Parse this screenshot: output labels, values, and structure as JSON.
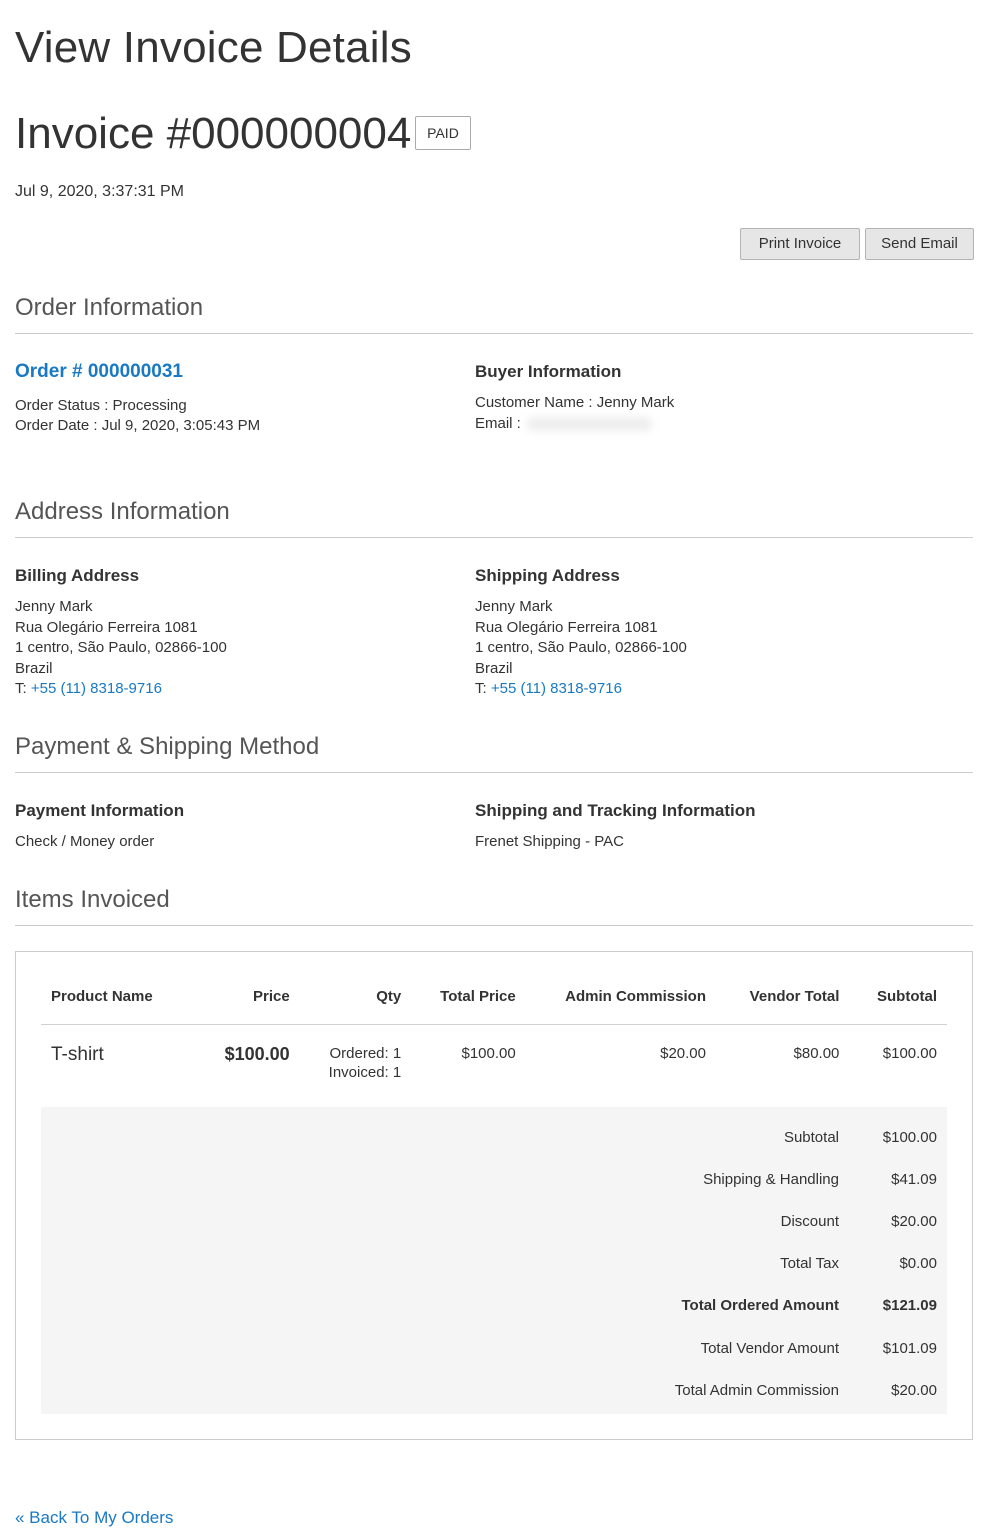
{
  "page_title": "View Invoice Details",
  "invoice": {
    "title": "Invoice #000000004",
    "status_badge": "PAID",
    "date": "Jul 9, 2020, 3:37:31 PM"
  },
  "actions": {
    "print_label": "Print Invoice",
    "email_label": "Send Email"
  },
  "order_info": {
    "section_title": "Order Information",
    "order_link": "Order # 000000031",
    "order_status": "Order Status : Processing",
    "order_date": "Order Date : Jul 9, 2020, 3:05:43 PM",
    "buyer_heading": "Buyer Information",
    "customer_name": "Customer Name : Jenny Mark",
    "email_label": "Email :"
  },
  "address_info": {
    "section_title": "Address Information",
    "billing": {
      "heading": "Billing Address",
      "lines": [
        "Jenny Mark",
        "Rua Olegário Ferreira 1081",
        "1 centro, São Paulo, 02866-100",
        "Brazil"
      ],
      "phone_prefix": "T:",
      "phone": "+55 (11) 8318-9716"
    },
    "shipping": {
      "heading": "Shipping Address",
      "lines": [
        "Jenny Mark",
        "Rua Olegário Ferreira 1081",
        "1 centro, São Paulo, 02866-100",
        "Brazil"
      ],
      "phone_prefix": "T:",
      "phone": "+55 (11) 8318-9716"
    }
  },
  "payment_shipping": {
    "section_title": "Payment & Shipping Method",
    "payment_heading": "Payment Information",
    "payment_method": "Check / Money order",
    "shipping_heading": "Shipping and Tracking Information",
    "shipping_method": "Frenet Shipping - PAC"
  },
  "items": {
    "section_title": "Items Invoiced",
    "columns": [
      "Product Name",
      "Price",
      "Qty",
      "Total Price",
      "Admin Commission",
      "Vendor Total",
      "Subtotal"
    ],
    "rows": [
      {
        "product": "T-shirt",
        "price": "$100.00",
        "qty_ordered": "Ordered: 1",
        "qty_invoiced": "Invoiced: 1",
        "total_price": "$100.00",
        "admin_commission": "$20.00",
        "vendor_total": "$80.00",
        "subtotal": "$100.00"
      }
    ],
    "totals": [
      {
        "label": "Subtotal",
        "value": "$100.00"
      },
      {
        "label": "Shipping & Handling",
        "value": "$41.09"
      },
      {
        "label": "Discount",
        "value": "$20.00"
      },
      {
        "label": "Total Tax",
        "value": "$0.00"
      },
      {
        "label": "Total Ordered Amount",
        "value": "$121.09"
      },
      {
        "label": "Total Vendor Amount",
        "value": "$101.09"
      },
      {
        "label": "Total Admin Commission",
        "value": "$20.00"
      }
    ]
  },
  "back_link": "« Back To My Orders",
  "colors": {
    "link": "#1979c3",
    "text": "#333333",
    "rule": "#cccccc",
    "totals_bg": "#f5f5f5"
  }
}
